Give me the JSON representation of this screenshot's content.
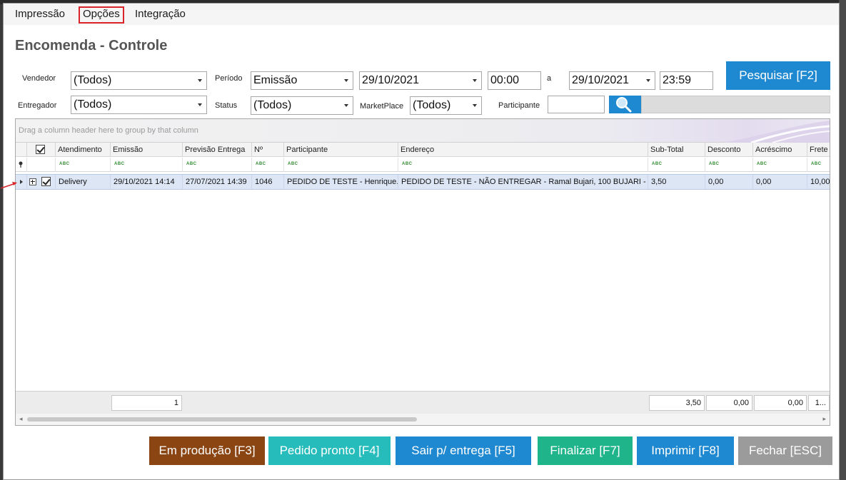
{
  "menu": {
    "impressao": "Impressão",
    "opcoes": "Opções",
    "integracao": "Integração"
  },
  "title": "Encomenda - Controle",
  "filters": {
    "vendedor_label": "Vendedor",
    "vendedor_value": "(Todos)",
    "periodo_label": "Período",
    "periodo_value": "Emissão",
    "date_from": "29/10/2021",
    "time_from": "00:00",
    "a_label": "a",
    "date_to": "29/10/2021",
    "time_to": "23:59",
    "entregador_label": "Entregador",
    "entregador_value": "(Todos)",
    "status_label": "Status",
    "status_value": "(Todos)",
    "marketplace_label": "MarketPlace",
    "marketplace_value": "(Todos)",
    "participante_label": "Participante",
    "participante_value": ""
  },
  "search_button": "Pesquisar [F2]",
  "grid": {
    "group_hint": "Drag a column header here to group by that column",
    "headers": [
      "Atendimento",
      "Emissão",
      "Previsão Entrega",
      "Nº",
      "Participante",
      "Endereço",
      "Sub-Total",
      "Desconto",
      "Acréscimo",
      "Frete"
    ],
    "filter_marker": "ABC",
    "rows": [
      {
        "atendimento": "Delivery",
        "emissao": "29/10/2021 14:14",
        "previsao": "27/07/2021 14:39",
        "numero": "1046",
        "participante": "PEDIDO DE TESTE - Henrique...",
        "endereco": "PEDIDO DE TESTE - NÃO ENTREGAR - Ramal Bujari, 100  BUJARI - Fo...",
        "subtotal": "3,50",
        "desconto": "0,00",
        "acrescimo": "0,00",
        "frete": "10,00"
      }
    ],
    "footer": {
      "count": "1",
      "subtotal": "3,50",
      "desconto": "0,00",
      "acrescimo": "0,00",
      "frete": "1..."
    }
  },
  "actions": {
    "em_producao": "Em produção [F3]",
    "pedido_pronto": "Pedido pronto [F4]",
    "sair_entrega": "Sair p/ entrega [F5]",
    "finalizar": "Finalizar [F7]",
    "imprimir": "Imprimir [F8]",
    "fechar": "Fechar [ESC]"
  },
  "colors": {
    "brown": "#8a4513",
    "teal": "#26bcbc",
    "blue": "#1e88d0",
    "green": "#20b48a",
    "gray": "#9b9b9b"
  }
}
